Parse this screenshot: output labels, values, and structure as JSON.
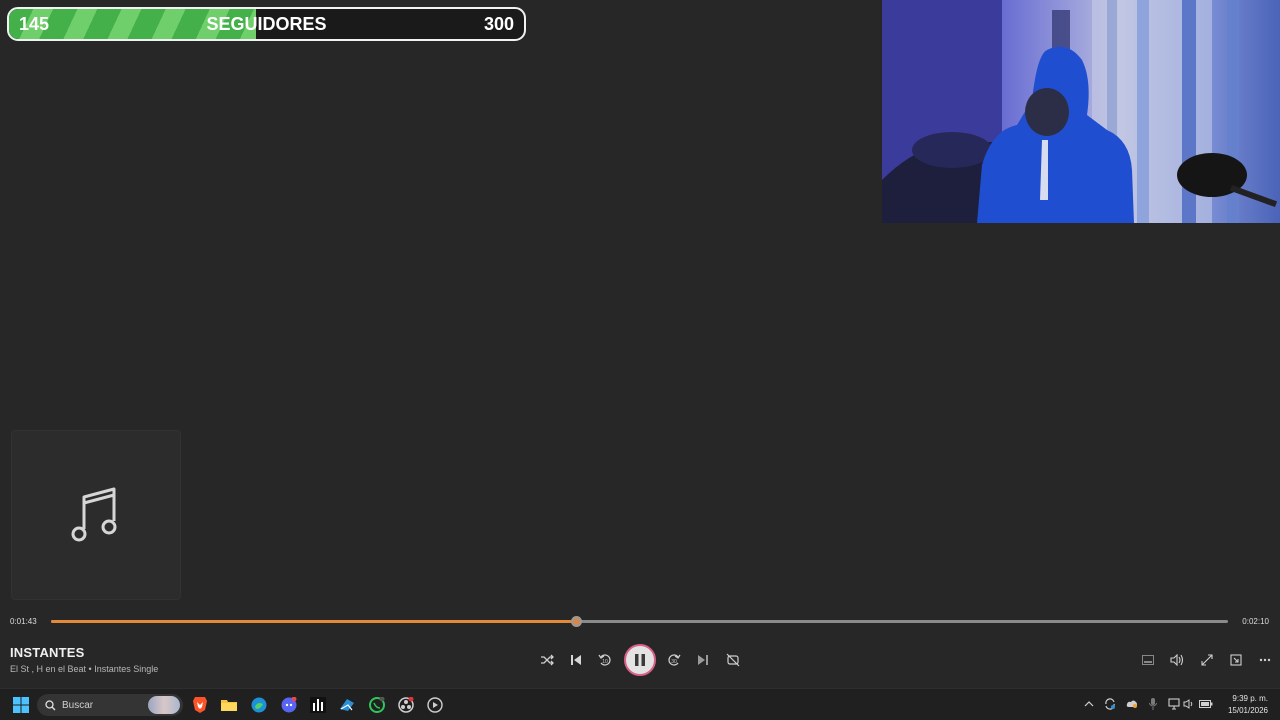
{
  "goal": {
    "current": "145",
    "label": "SEGUIDORES",
    "target": "300",
    "progress_fraction": 0.48
  },
  "player": {
    "time_current": "0:01:43",
    "time_total": "0:02:10",
    "progress_fraction": 0.446,
    "title": "INSTANTES",
    "subtitle": "El St , H en el Beat • Instantes Single",
    "accent": "#e38a3a",
    "album_art_icon": "music-note-icon"
  },
  "taskbar": {
    "search_placeholder": "Buscar",
    "clock_time": "9:39 p. m.",
    "clock_date": "15/01/2026"
  }
}
